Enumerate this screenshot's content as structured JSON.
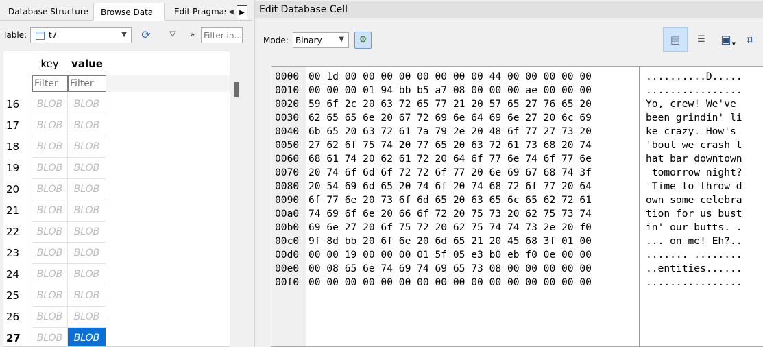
{
  "left_tabs": [
    "Database Structure",
    "Browse Data",
    "Edit Pragmas"
  ],
  "table_bar": {
    "label": "Table:",
    "selected_table": "t7",
    "more_label": "»",
    "filter_placeholder": "Filter in..."
  },
  "grid": {
    "columns": [
      "key",
      "value"
    ],
    "filter_placeholder": "Filter",
    "rows": [
      {
        "n": "16",
        "key": "BLOB",
        "value": "BLOB"
      },
      {
        "n": "17",
        "key": "BLOB",
        "value": "BLOB"
      },
      {
        "n": "18",
        "key": "BLOB",
        "value": "BLOB"
      },
      {
        "n": "19",
        "key": "BLOB",
        "value": "BLOB"
      },
      {
        "n": "20",
        "key": "BLOB",
        "value": "BLOB"
      },
      {
        "n": "21",
        "key": "BLOB",
        "value": "BLOB"
      },
      {
        "n": "22",
        "key": "BLOB",
        "value": "BLOB"
      },
      {
        "n": "23",
        "key": "BLOB",
        "value": "BLOB"
      },
      {
        "n": "24",
        "key": "BLOB",
        "value": "BLOB"
      },
      {
        "n": "25",
        "key": "BLOB",
        "value": "BLOB"
      },
      {
        "n": "26",
        "key": "BLOB",
        "value": "BLOB"
      },
      {
        "n": "27",
        "key": "BLOB",
        "value": "BLOB"
      }
    ]
  },
  "edit_cell": {
    "title": "Edit Database Cell",
    "mode_label": "Mode:",
    "mode_value": "Binary",
    "hex_rows": [
      {
        "addr": "0000",
        "hex": "00 1d 00 00 00 00 00 00 00 00 44 00 00 00 00 00",
        "ascii": "..........D....."
      },
      {
        "addr": "0010",
        "hex": "00 00 00 01 94 bb b5 a7 08 00 00 00 ae 00 00 00",
        "ascii": "................"
      },
      {
        "addr": "0020",
        "hex": "59 6f 2c 20 63 72 65 77 21 20 57 65 27 76 65 20",
        "ascii": "Yo, crew! We've "
      },
      {
        "addr": "0030",
        "hex": "62 65 65 6e 20 67 72 69 6e 64 69 6e 27 20 6c 69",
        "ascii": "been grindin' li"
      },
      {
        "addr": "0040",
        "hex": "6b 65 20 63 72 61 7a 79 2e 20 48 6f 77 27 73 20",
        "ascii": "ke crazy. How's "
      },
      {
        "addr": "0050",
        "hex": "27 62 6f 75 74 20 77 65 20 63 72 61 73 68 20 74",
        "ascii": "'bout we crash t"
      },
      {
        "addr": "0060",
        "hex": "68 61 74 20 62 61 72 20 64 6f 77 6e 74 6f 77 6e",
        "ascii": "hat bar downtown"
      },
      {
        "addr": "0070",
        "hex": "20 74 6f 6d 6f 72 72 6f 77 20 6e 69 67 68 74 3f",
        "ascii": " tomorrow night?"
      },
      {
        "addr": "0080",
        "hex": "20 54 69 6d 65 20 74 6f 20 74 68 72 6f 77 20 64",
        "ascii": " Time to throw d"
      },
      {
        "addr": "0090",
        "hex": "6f 77 6e 20 73 6f 6d 65 20 63 65 6c 65 62 72 61",
        "ascii": "own some celebra"
      },
      {
        "addr": "00a0",
        "hex": "74 69 6f 6e 20 66 6f 72 20 75 73 20 62 75 73 74",
        "ascii": "tion for us bust"
      },
      {
        "addr": "00b0",
        "hex": "69 6e 27 20 6f 75 72 20 62 75 74 74 73 2e 20 f0",
        "ascii": "in' our butts. ."
      },
      {
        "addr": "00c0",
        "hex": "9f 8d bb 20 6f 6e 20 6d 65 21 20 45 68 3f 01 00",
        "ascii": "... on me! Eh?.."
      },
      {
        "addr": "00d0",
        "hex": "00 00 19 00 00 00 01 5f 05 e3 b0 eb f0 0e 00 00",
        "ascii": "....... ........"
      },
      {
        "addr": "00e0",
        "hex": "00 08 65 6e 74 69 74 69 65 73 08 00 00 00 00 00",
        "ascii": "..entities......"
      },
      {
        "addr": "00f0",
        "hex": "00 00 00 00 00 00 00 00 00 00 00 00 00 00 00 00",
        "ascii": "................"
      }
    ]
  },
  "icons": {
    "table": "table-icon",
    "refresh": "refresh-icon",
    "clear_filter": "clear-filter-icon",
    "auto_switch": "auto-switch-mode-icon",
    "text_mode": "text-mode-icon",
    "word_wrap": "word-wrap-icon",
    "export": "export-icon",
    "import": "import-icon"
  },
  "colors": {
    "selection": "#0a6fd6",
    "blob_text": "#bdbdbd",
    "toggle_active": "#cde4fa"
  }
}
